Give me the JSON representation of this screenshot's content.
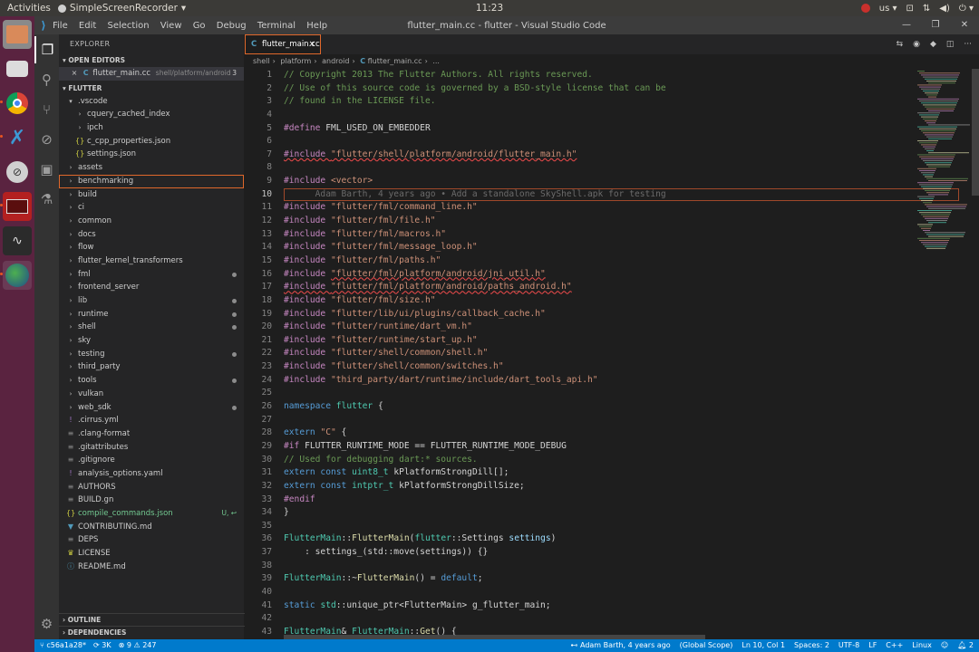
{
  "top_panel": {
    "activities": "Activities",
    "app_name": "SimpleScreenRecorder",
    "clock": "11:23",
    "tray_lang": "us"
  },
  "titlebar": {
    "menu": [
      "File",
      "Edit",
      "Selection",
      "View",
      "Go",
      "Debug",
      "Terminal",
      "Help"
    ],
    "title": "flutter_main.cc - flutter - Visual Studio Code"
  },
  "sidebar": {
    "title": "EXPLORER",
    "open_editors_label": "OPEN EDITORS",
    "open_editor": {
      "name": "flutter_main.cc",
      "path": "shell/platform/android",
      "count": "3"
    },
    "root_label": "FLUTTER",
    "tree": [
      {
        "label": ".vscode",
        "depth": 0,
        "kind": "folder-open",
        "dot": false
      },
      {
        "label": "cquery_cached_index",
        "depth": 1,
        "kind": "folder",
        "dot": false
      },
      {
        "label": "ipch",
        "depth": 1,
        "kind": "folder",
        "dot": false
      },
      {
        "label": "c_cpp_properties.json",
        "depth": 1,
        "kind": "json",
        "dot": false
      },
      {
        "label": "settings.json",
        "depth": 1,
        "kind": "json",
        "dot": false
      },
      {
        "label": "assets",
        "depth": 0,
        "kind": "folder",
        "dot": false
      },
      {
        "label": "benchmarking",
        "depth": 0,
        "kind": "folder",
        "dot": false,
        "selected": true
      },
      {
        "label": "build",
        "depth": 0,
        "kind": "folder",
        "dot": false
      },
      {
        "label": "ci",
        "depth": 0,
        "kind": "folder",
        "dot": false
      },
      {
        "label": "common",
        "depth": 0,
        "kind": "folder",
        "dot": false
      },
      {
        "label": "docs",
        "depth": 0,
        "kind": "folder",
        "dot": false
      },
      {
        "label": "flow",
        "depth": 0,
        "kind": "folder",
        "dot": false
      },
      {
        "label": "flutter_kernel_transformers",
        "depth": 0,
        "kind": "folder",
        "dot": false
      },
      {
        "label": "fml",
        "depth": 0,
        "kind": "folder",
        "dot": true
      },
      {
        "label": "frontend_server",
        "depth": 0,
        "kind": "folder",
        "dot": false
      },
      {
        "label": "lib",
        "depth": 0,
        "kind": "folder",
        "dot": true
      },
      {
        "label": "runtime",
        "depth": 0,
        "kind": "folder",
        "dot": true
      },
      {
        "label": "shell",
        "depth": 0,
        "kind": "folder",
        "dot": true
      },
      {
        "label": "sky",
        "depth": 0,
        "kind": "folder",
        "dot": false
      },
      {
        "label": "testing",
        "depth": 0,
        "kind": "folder",
        "dot": true
      },
      {
        "label": "third_party",
        "depth": 0,
        "kind": "folder",
        "dot": false
      },
      {
        "label": "tools",
        "depth": 0,
        "kind": "folder",
        "dot": true
      },
      {
        "label": "vulkan",
        "depth": 0,
        "kind": "folder",
        "dot": false
      },
      {
        "label": "web_sdk",
        "depth": 0,
        "kind": "folder",
        "dot": true
      },
      {
        "label": ".cirrus.yml",
        "depth": 0,
        "kind": "yml",
        "dot": false
      },
      {
        "label": ".clang-format",
        "depth": 0,
        "kind": "file",
        "dot": false
      },
      {
        "label": ".gitattributes",
        "depth": 0,
        "kind": "file",
        "dot": false
      },
      {
        "label": ".gitignore",
        "depth": 0,
        "kind": "file",
        "dot": false
      },
      {
        "label": "analysis_options.yaml",
        "depth": 0,
        "kind": "yml",
        "dot": false
      },
      {
        "label": "AUTHORS",
        "depth": 0,
        "kind": "file",
        "dot": false
      },
      {
        "label": "BUILD.gn",
        "depth": 0,
        "kind": "file",
        "dot": false
      },
      {
        "label": "compile_commands.json",
        "depth": 0,
        "kind": "json",
        "dot": false,
        "badge": "U, ↩",
        "green": true
      },
      {
        "label": "CONTRIBUTING.md",
        "depth": 0,
        "kind": "md",
        "dot": false
      },
      {
        "label": "DEPS",
        "depth": 0,
        "kind": "file",
        "dot": false
      },
      {
        "label": "LICENSE",
        "depth": 0,
        "kind": "license",
        "dot": false
      },
      {
        "label": "README.md",
        "depth": 0,
        "kind": "info",
        "dot": false
      }
    ],
    "outline_label": "OUTLINE",
    "dependencies_label": "DEPENDENCIES"
  },
  "tabs": [
    {
      "label": "flutter_main.cc",
      "close": "×"
    }
  ],
  "breadcrumb": [
    "shell",
    "platform",
    "android",
    "flutter_main.cc",
    "..."
  ],
  "editor": {
    "current_line": 10,
    "lines": [
      [
        [
          "t-com",
          "// Copyright 2013 The Flutter Authors. All rights reserved."
        ]
      ],
      [
        [
          "t-com",
          "// Use of this source code is governed by a BSD-style license that can be"
        ]
      ],
      [
        [
          "t-com",
          "// found in the LICENSE file."
        ]
      ],
      [],
      [
        [
          "t-pre",
          "#define "
        ],
        [
          "t-mac",
          "FML_USED_ON_EMBEDDER"
        ]
      ],
      [],
      [
        [
          "t-pre squig",
          "#include "
        ],
        [
          "t-str squig",
          "\"flutter/shell/platform/android/flutter_main.h\""
        ]
      ],
      [],
      [
        [
          "t-pre",
          "#include "
        ],
        [
          "t-str",
          "<vector>"
        ]
      ],
      [
        [
          "t-blame",
          "      Adam Barth, 4 years ago • Add a standalone SkyShell.apk for testing"
        ]
      ],
      [
        [
          "t-pre",
          "#include "
        ],
        [
          "t-str",
          "\"flutter/fml/command_line.h\""
        ]
      ],
      [
        [
          "t-pre",
          "#include "
        ],
        [
          "t-str",
          "\"flutter/fml/file.h\""
        ]
      ],
      [
        [
          "t-pre",
          "#include "
        ],
        [
          "t-str",
          "\"flutter/fml/macros.h\""
        ]
      ],
      [
        [
          "t-pre",
          "#include "
        ],
        [
          "t-str",
          "\"flutter/fml/message_loop.h\""
        ]
      ],
      [
        [
          "t-pre",
          "#include "
        ],
        [
          "t-str",
          "\"flutter/fml/paths.h\""
        ]
      ],
      [
        [
          "t-pre",
          "#include "
        ],
        [
          "t-str squig",
          "\"flutter/fml/platform/android/jni_util.h\""
        ]
      ],
      [
        [
          "t-pre squig",
          "#include "
        ],
        [
          "t-str squig",
          "\"flutter/fml/platform/android/paths_android.h\""
        ]
      ],
      [
        [
          "t-pre",
          "#include "
        ],
        [
          "t-str",
          "\"flutter/fml/size.h\""
        ]
      ],
      [
        [
          "t-pre",
          "#include "
        ],
        [
          "t-str",
          "\"flutter/lib/ui/plugins/callback_cache.h\""
        ]
      ],
      [
        [
          "t-pre",
          "#include "
        ],
        [
          "t-str",
          "\"flutter/runtime/dart_vm.h\""
        ]
      ],
      [
        [
          "t-pre",
          "#include "
        ],
        [
          "t-str",
          "\"flutter/runtime/start_up.h\""
        ]
      ],
      [
        [
          "t-pre",
          "#include "
        ],
        [
          "t-str",
          "\"flutter/shell/common/shell.h\""
        ]
      ],
      [
        [
          "t-pre",
          "#include "
        ],
        [
          "t-str",
          "\"flutter/shell/common/switches.h\""
        ]
      ],
      [
        [
          "t-pre",
          "#include "
        ],
        [
          "t-str",
          "\"third_party/dart/runtime/include/dart_tools_api.h\""
        ]
      ],
      [],
      [
        [
          "t-kw",
          "namespace "
        ],
        [
          "t-type",
          "flutter"
        ],
        [
          "t-mac",
          " {"
        ]
      ],
      [],
      [
        [
          "t-kw",
          "extern "
        ],
        [
          "t-str",
          "\"C\""
        ],
        [
          "t-mac",
          " {"
        ]
      ],
      [
        [
          "t-pre",
          "#if "
        ],
        [
          "t-mac",
          "FLUTTER_RUNTIME_MODE == FLUTTER_RUNTIME_MODE_DEBUG"
        ]
      ],
      [
        [
          "t-com",
          "// Used for debugging dart:* sources."
        ]
      ],
      [
        [
          "t-kw",
          "extern const "
        ],
        [
          "t-type",
          "uint8_t "
        ],
        [
          "t-mac",
          "kPlatformStrongDill[];"
        ]
      ],
      [
        [
          "t-kw",
          "extern const "
        ],
        [
          "t-type",
          "intptr_t "
        ],
        [
          "t-mac",
          "kPlatformStrongDillSize;"
        ]
      ],
      [
        [
          "t-pre",
          "#endif"
        ]
      ],
      [
        [
          "t-mac",
          "}"
        ]
      ],
      [],
      [
        [
          "t-type",
          "FlutterMain"
        ],
        [
          "t-mac",
          "::"
        ],
        [
          "t-fn",
          "FlutterMain"
        ],
        [
          "t-mac",
          "("
        ],
        [
          "t-type",
          "flutter"
        ],
        [
          "t-mac",
          "::Settings "
        ],
        [
          "t-var",
          "settings"
        ],
        [
          "t-mac",
          ")"
        ]
      ],
      [
        [
          "t-mac",
          "    : settings_(std::move(settings)) {}"
        ]
      ],
      [],
      [
        [
          "t-type",
          "FlutterMain"
        ],
        [
          "t-mac",
          "::~"
        ],
        [
          "t-fn",
          "FlutterMain"
        ],
        [
          "t-mac",
          "() = "
        ],
        [
          "t-kw",
          "default"
        ],
        [
          "t-mac",
          ";"
        ]
      ],
      [],
      [
        [
          "t-kw",
          "static "
        ],
        [
          "t-type",
          "std"
        ],
        [
          "t-mac",
          "::unique_ptr<FlutterMain> g_flutter_main;"
        ]
      ],
      [],
      [
        [
          "t-type",
          "FlutterMain"
        ],
        [
          "t-mac",
          "& "
        ],
        [
          "t-type",
          "FlutterMain"
        ],
        [
          "t-mac",
          "::"
        ],
        [
          "t-fn",
          "Get"
        ],
        [
          "t-mac",
          "() {"
        ]
      ]
    ],
    "line_numbers": [
      "1",
      "2",
      "3",
      "4",
      "5",
      "6",
      "7",
      "8",
      "9",
      "10",
      "11",
      "12",
      "13",
      "14",
      "15",
      "16",
      "17",
      "18",
      "19",
      "20",
      "21",
      "22",
      "23",
      "24",
      "25",
      "26",
      "27",
      "28",
      "29",
      "30",
      "31",
      "32",
      "33",
      "34",
      "35",
      "36",
      "37",
      "38",
      "39",
      "40",
      "41",
      "42",
      "43"
    ]
  },
  "statusbar": {
    "branch": "c56a1a28*",
    "sync": "3K",
    "errors": "9",
    "warnings": "247",
    "blame": "Adam Barth, 4 years ago",
    "scope": "(Global Scope)",
    "position": "Ln 10, Col 1",
    "spaces": "Spaces: 2",
    "encoding": "UTF-8",
    "eol": "LF",
    "language": "C++",
    "platform": "Linux",
    "notifications": "2"
  },
  "colors": {
    "accent": "#007acc",
    "dock": "#5a2340",
    "focus": "#e0682b"
  }
}
